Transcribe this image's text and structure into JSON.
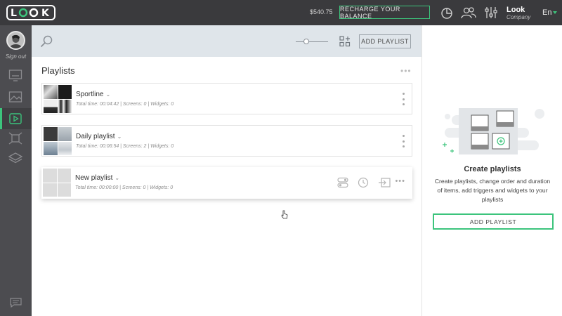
{
  "brand": {
    "logo_text": "LOOK"
  },
  "topbar": {
    "balance": "$540.75",
    "recharge_label": "RECHARGE YOUR BALANCE",
    "user": {
      "name": "Look",
      "company": "Company"
    },
    "language": "En"
  },
  "sidebar": {
    "signout_label": "Sign out",
    "items": [
      {
        "icon": "display-icon"
      },
      {
        "icon": "image-icon"
      },
      {
        "icon": "playlist-icon",
        "active": true
      },
      {
        "icon": "widgets-icon"
      },
      {
        "icon": "layers-icon"
      }
    ]
  },
  "toolbar": {
    "add_playlist_label": "ADD PLAYLIST"
  },
  "playlists": {
    "title": "Playlists",
    "items": [
      {
        "name": "Sportline",
        "meta": "Total time: 00:04:42  |  Screens: 0  |  Widgets: 0"
      },
      {
        "name": "Daily playlist",
        "meta": "Total time: 00:06:54  |  Screens: 2  |  Widgets: 0"
      },
      {
        "name": "New playlist",
        "meta": "Total time: 00:00:00  |  Screens: 0  |  Widgets: 0"
      }
    ]
  },
  "panel": {
    "title": "Create playlists",
    "text": "Create playlists, change order and duration of items, add triggers and widgets to your playlists",
    "button_label": "ADD PLAYLIST"
  },
  "colors": {
    "accent": "#3cc47c",
    "topbar": "#3a3a3d",
    "sidebar": "#4c4c50",
    "toolbar": "#dfe5ea"
  }
}
